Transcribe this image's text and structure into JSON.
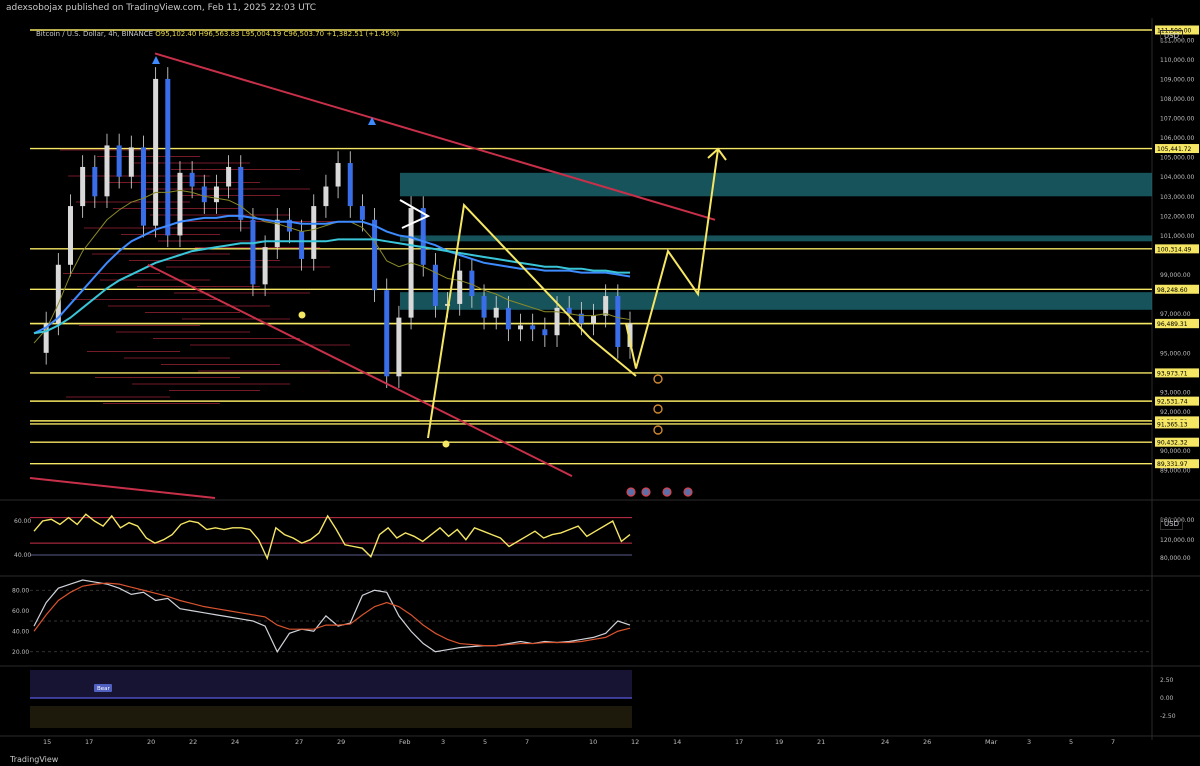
{
  "header": {
    "published": "adexsobojax published on TradingView.com, Feb 11, 2025 22:03 UTC",
    "symbol": "Bitcoin / U.S. Dollar, 4h, BINANCE",
    "open": "O95,102.40",
    "high": "H96,563.83",
    "low": "L95,004.19",
    "close": "C96,503.70",
    "change": "+1,382.51 (+1.45%)",
    "currency": "USD",
    "currency_lower": "USD"
  },
  "footer": {
    "brand": "TradingView"
  },
  "colors": {
    "level_line": "#f5e663",
    "trendline": "#c8304a",
    "zone": "#1f6f7a",
    "ema_blue": "#3d8bff",
    "ema_cyan": "#38c6d8",
    "ema_olive": "#8a8a2a",
    "projection": "#f5e663",
    "candle": "#3a6ee8",
    "volume_profile": "#8a1f2e"
  },
  "chart_data": [
    {
      "type": "line",
      "title": "",
      "panel": "price",
      "x_ticks": [
        "15",
        "17",
        "20",
        "22",
        "24",
        "27",
        "29",
        "Feb",
        "3",
        "5",
        "7",
        "10",
        "12",
        "14",
        "17",
        "19",
        "21",
        "24",
        "26",
        "Mar",
        "3",
        "5",
        "7"
      ],
      "y_ticks": [
        "111,000.00",
        "110,000.00",
        "109,000.00",
        "108,000.00",
        "107,000.00",
        "106,000.00",
        "105,000.00",
        "104,000.00",
        "103,000.00",
        "102,000.00",
        "101,000.00",
        "99,000.00",
        "97,000.00",
        "95,000.00",
        "93,000.00",
        "92,000.00",
        "90,000.00",
        "89,000.00"
      ],
      "ylim": [
        88500,
        111500
      ],
      "horizontal_levels": [
        {
          "value": 111500,
          "label": "111,500.00"
        },
        {
          "value": 105441.72,
          "label": "105,441.72"
        },
        {
          "value": 100314.49,
          "label": "100,314.49"
        },
        {
          "value": 98248.6,
          "label": "98,248.60"
        },
        {
          "value": 96503.7,
          "label": "96,503.70"
        },
        {
          "value": 96489.31,
          "label": "96,489.31"
        },
        {
          "value": 93973.71,
          "label": "93,973.71"
        },
        {
          "value": 92531.74,
          "label": "92,531.74"
        },
        {
          "value": 91521.79,
          "label": "91,521.79"
        },
        {
          "value": 91365.13,
          "label": "91,365.13"
        },
        {
          "value": 90432.32,
          "label": "90,432.32"
        },
        {
          "value": 89331.97,
          "label": "89,331.97"
        }
      ],
      "zones": [
        {
          "from": 103000,
          "to": 104200
        },
        {
          "from": 100700,
          "to": 101000
        },
        {
          "from": 97200,
          "to": 98100
        }
      ],
      "series": [
        {
          "values": [
            95000,
            96500,
            99500,
            102500,
            104500,
            103000,
            105600,
            104000,
            105500,
            101500,
            109000,
            101000,
            104200,
            103500,
            102700,
            103500,
            104500,
            101800,
            98500,
            100400,
            101800,
            101200,
            99800,
            102500,
            103500,
            104700,
            102500,
            101800,
            98200,
            93800,
            96800,
            102400,
            99500,
            97400,
            97500,
            99200,
            97900,
            96800,
            97300,
            96200,
            96400,
            96200,
            95900,
            97300,
            97000,
            96500,
            96900,
            97900,
            95300,
            96504
          ]
        },
        {
          "values": [
            95500,
            96200,
            97500,
            99000,
            100200,
            101000,
            101800,
            102300,
            102700,
            102900,
            103200,
            103200,
            103300,
            103200,
            103000,
            102900,
            102800,
            102500,
            102000,
            101700,
            101600,
            101400,
            101200,
            101300,
            101500,
            101700,
            101700,
            101400,
            100700,
            99700,
            99400,
            99600,
            99400,
            99100,
            98800,
            98700,
            98500,
            98200,
            98000,
            97700,
            97500,
            97300,
            97100,
            97100,
            97000,
            96900,
            96900,
            97000,
            96800,
            96700
          ]
        },
        {
          "values": [
            96000,
            96300,
            96800,
            97500,
            98200,
            98900,
            99600,
            100200,
            100700,
            101000,
            101300,
            101500,
            101700,
            101800,
            101900,
            101900,
            102000,
            102000,
            101900,
            101800,
            101700,
            101700,
            101600,
            101600,
            101600,
            101700,
            101700,
            101700,
            101500,
            101200,
            101000,
            100900,
            100700,
            100500,
            100200,
            100000,
            99800,
            99600,
            99500,
            99400,
            99300,
            99300,
            99200,
            99200,
            99200,
            99100,
            99100,
            99100,
            99000,
            98900
          ]
        },
        {
          "values": [
            96000,
            96100,
            96400,
            96800,
            97300,
            97800,
            98300,
            98700,
            99000,
            99300,
            99600,
            99800,
            100000,
            100200,
            100300,
            100400,
            100500,
            100600,
            100600,
            100700,
            100700,
            100700,
            100700,
            100700,
            100700,
            100800,
            100800,
            100800,
            100800,
            100700,
            100600,
            100500,
            100400,
            100300,
            100200,
            100100,
            100000,
            99900,
            99800,
            99700,
            99600,
            99500,
            99400,
            99400,
            99300,
            99300,
            99200,
            99200,
            99100,
            99100
          ]
        }
      ],
      "projection": [
        96500,
        94200,
        100200,
        98000,
        105400
      ],
      "projection_x": [
        "Feb 11",
        "Feb 12",
        "Feb 13",
        "Feb 14",
        "Feb 16"
      ]
    },
    {
      "type": "line",
      "panel": "indicator_1",
      "y_ticks": [
        "60.00",
        "40.00"
      ],
      "right_ticks": [
        "160,000.00",
        "120,000.00",
        "80,000.00"
      ],
      "series": [
        {
          "values": [
            54,
            60,
            61,
            58,
            62,
            58,
            64,
            60,
            57,
            63,
            56,
            59,
            57,
            50,
            47,
            49,
            52,
            58,
            60,
            59,
            55,
            56,
            55,
            56,
            56,
            55,
            49,
            38,
            56,
            52,
            50,
            47,
            49,
            53,
            63,
            55,
            46,
            45,
            44,
            39,
            52,
            56,
            50,
            53,
            51,
            48,
            52,
            56,
            51,
            55,
            49,
            56,
            54,
            52,
            50,
            45,
            48,
            51,
            54,
            50,
            52,
            53,
            55,
            57,
            51,
            54,
            57,
            60,
            48,
            52
          ]
        }
      ]
    },
    {
      "type": "line",
      "panel": "indicator_2",
      "y_ticks": [
        "80.00",
        "60.00",
        "40.00",
        "20.00"
      ],
      "series": [
        {
          "values": [
            45,
            68,
            82,
            86,
            90,
            88,
            86,
            82,
            76,
            78,
            70,
            72,
            62,
            60,
            58,
            56,
            54,
            52,
            50,
            45,
            20,
            38,
            42,
            40,
            55,
            45,
            48,
            75,
            80,
            78,
            55,
            40,
            28,
            20,
            22,
            24,
            25,
            26,
            26,
            28,
            30,
            28,
            30,
            29,
            30,
            32,
            34,
            38,
            50,
            46
          ]
        },
        {
          "values": [
            40,
            56,
            70,
            78,
            84,
            86,
            87,
            86,
            83,
            80,
            77,
            74,
            70,
            67,
            64,
            62,
            60,
            58,
            56,
            54,
            46,
            42,
            42,
            42,
            46,
            46,
            47,
            56,
            64,
            68,
            64,
            56,
            46,
            38,
            32,
            28,
            27,
            26,
            26,
            27,
            28,
            28,
            29,
            29,
            29,
            30,
            32,
            34,
            40,
            43
          ]
        }
      ]
    },
    {
      "type": "area",
      "panel": "indicator_3",
      "y_ticks": [
        "2.50",
        "0.00",
        "-2.50"
      ],
      "annotation": "Bear"
    }
  ]
}
